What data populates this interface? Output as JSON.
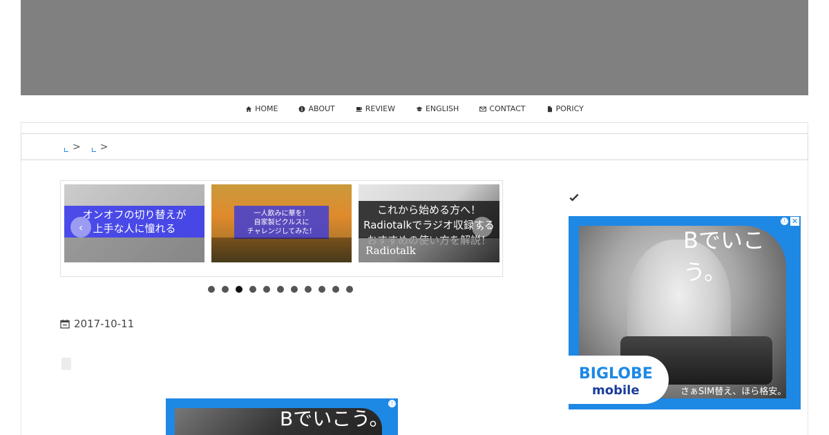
{
  "nav": {
    "items": [
      {
        "label": "HOME",
        "icon": "home-icon"
      },
      {
        "label": "ABOUT",
        "icon": "info-circle-icon"
      },
      {
        "label": "REVIEW",
        "icon": "coffee-icon"
      },
      {
        "label": "ENGLISH",
        "icon": "graduation-cap-icon"
      },
      {
        "label": "CONTACT",
        "icon": "envelope-icon"
      },
      {
        "label": "PORICY",
        "icon": "file-icon"
      }
    ]
  },
  "breadcrumb": {
    "separator": ">"
  },
  "slider": {
    "slides": [
      {
        "caption": "オンオフの切り替えが\n上手な人に憧れる",
        "title": ""
      },
      {
        "caption": "一人飲みに華を！\n自家製ピクルスに\nチャレンジしてみた！",
        "title": ""
      },
      {
        "caption": "これから始める方へ！\nRadiotalkでラジオ収録する\nおすすめの使い方を解説！",
        "title": "Radiotalk"
      }
    ],
    "prev_arrow": "‹",
    "next_arrow": "›",
    "dot_count": 11,
    "active_dot": 3
  },
  "post": {
    "date": "2017-10-11"
  },
  "ads": {
    "headline": "Bでいこう。",
    "logo_top": "BIGLOBE",
    "logo_bottom": "mobile",
    "tagline": "さぁSIM替え、ほら格安。",
    "info_glyph": "ⓘ",
    "close_glyph": "✕"
  },
  "colors": {
    "header_banner": "#808080",
    "ad_blue": "#1e88e5",
    "link_blue": "#1e88e5"
  }
}
